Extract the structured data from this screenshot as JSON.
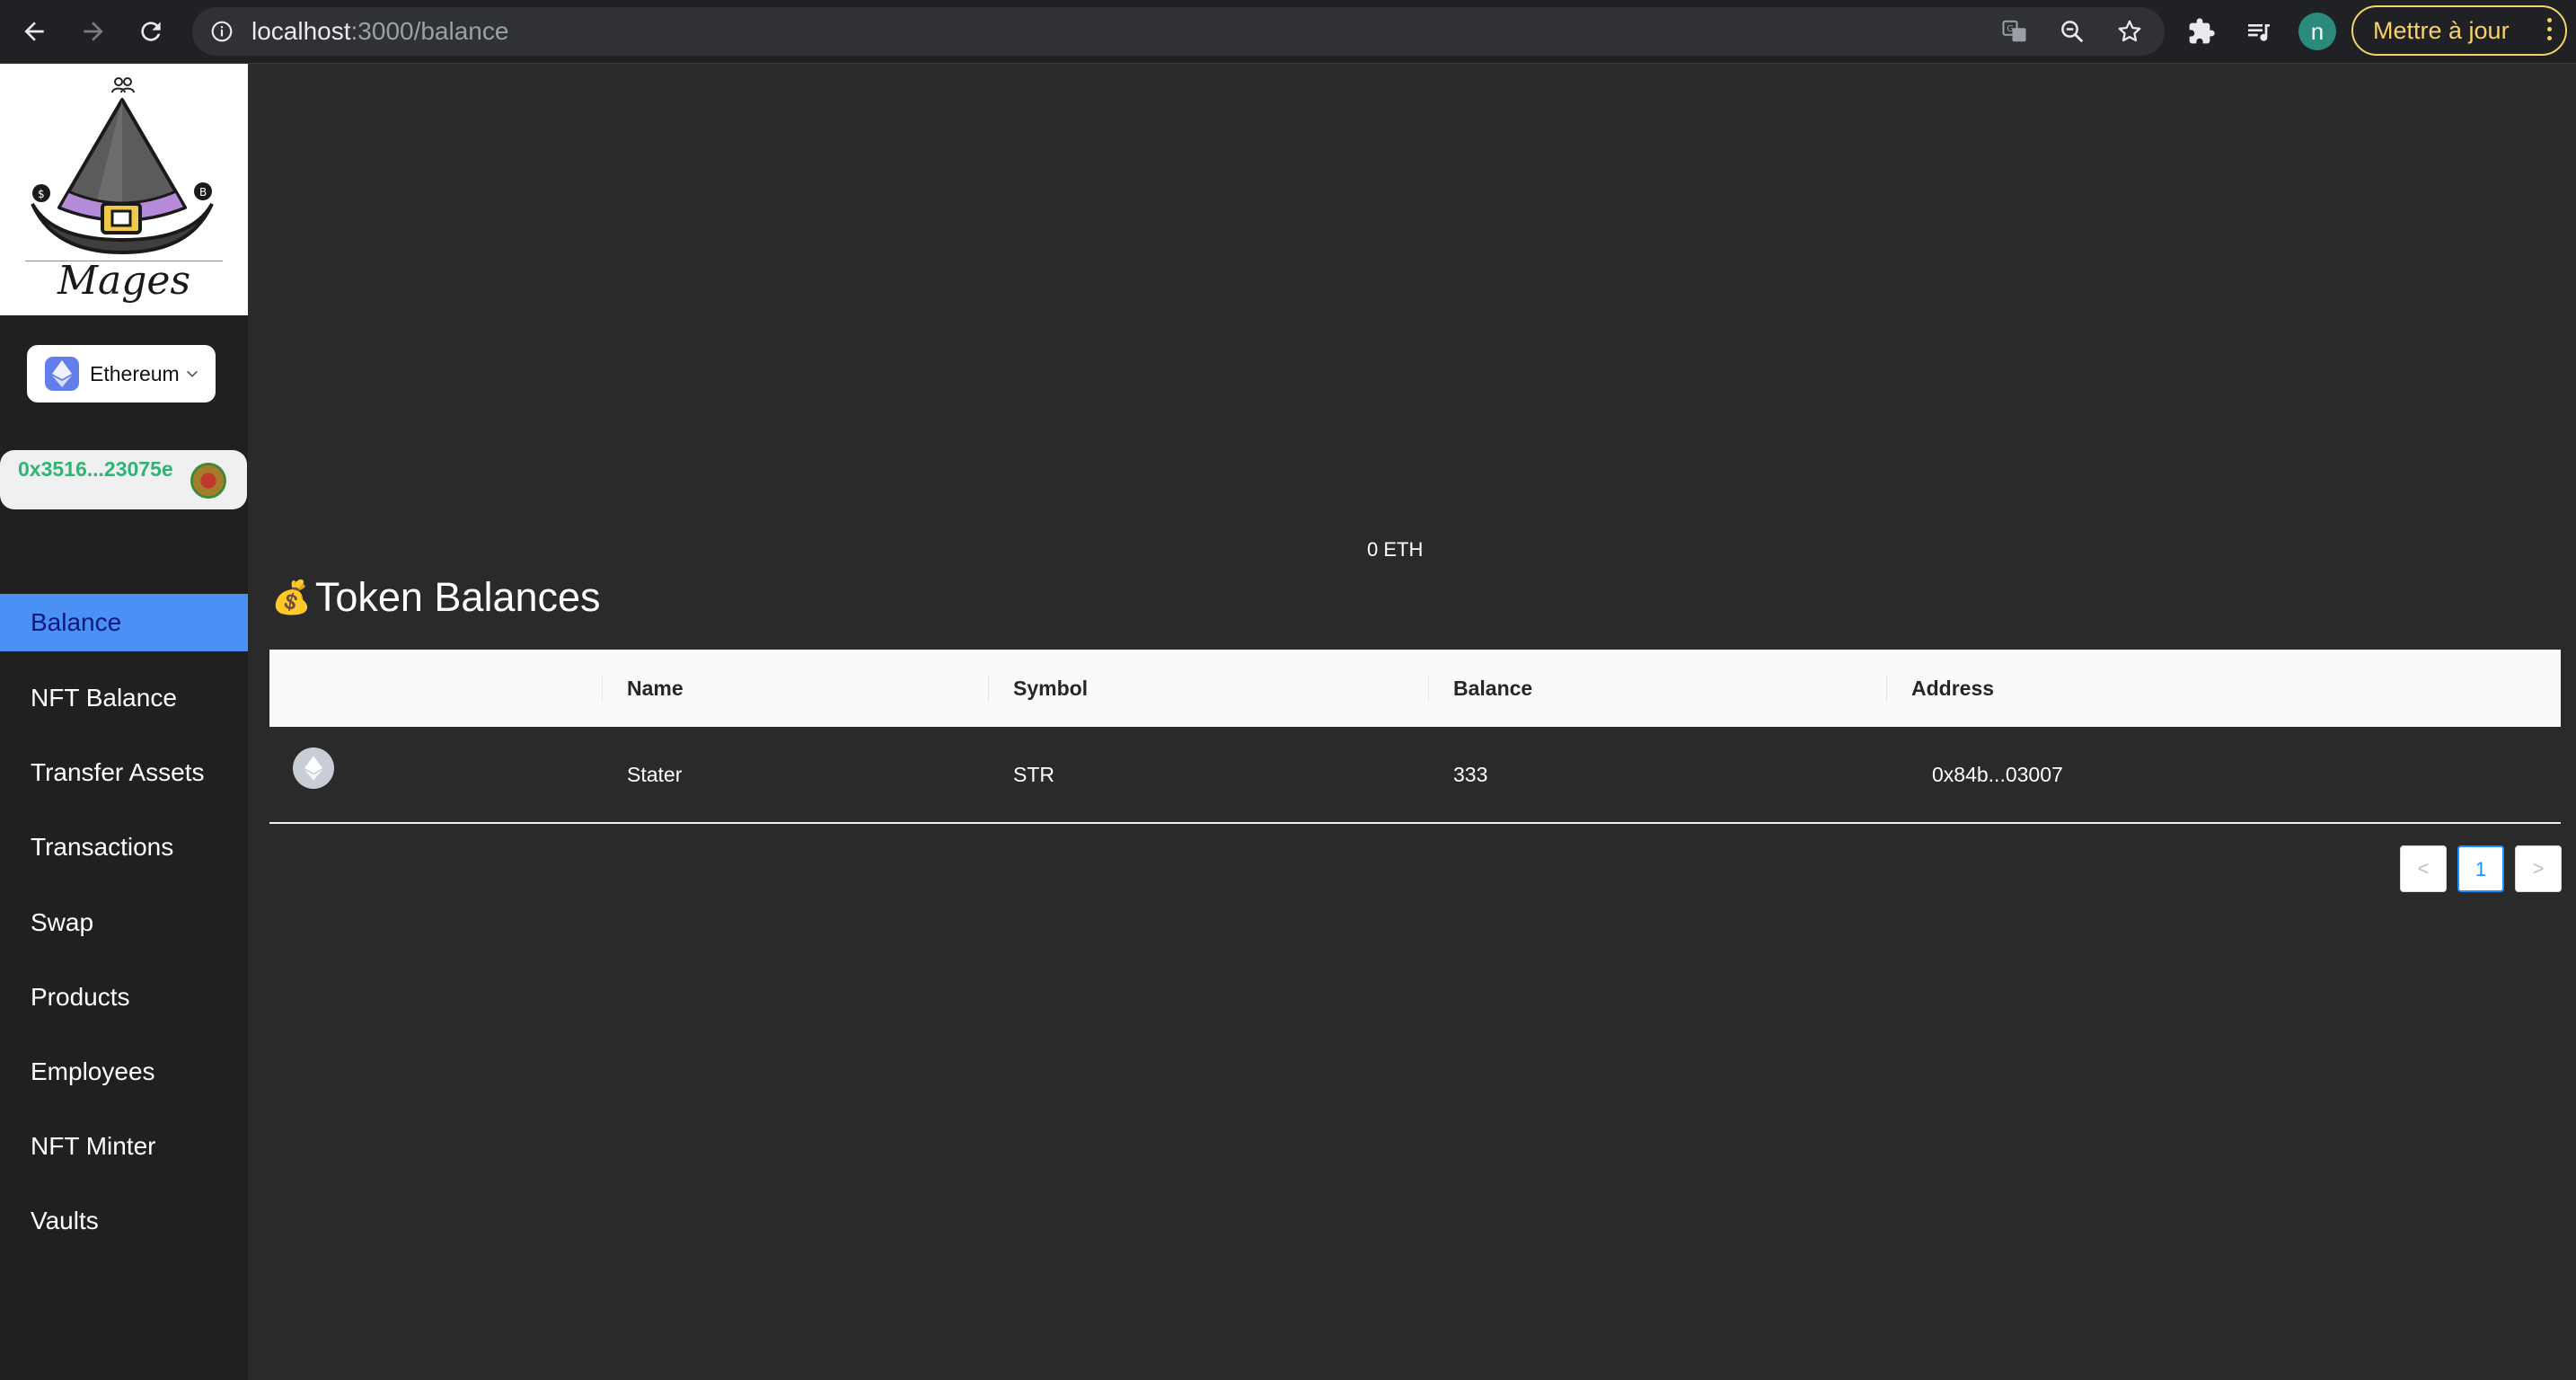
{
  "browser": {
    "url_host": "localhost",
    "url_path": ":3000/balance",
    "profile_initial": "n",
    "update_label": "Mettre à jour"
  },
  "sidebar": {
    "logo_text": "Mages",
    "chain": {
      "label": "Ethereum"
    },
    "account": {
      "address": "0x3516...23075e"
    },
    "menu": [
      {
        "label": "Balance",
        "active": true
      },
      {
        "label": "NFT Balance"
      },
      {
        "label": "Transfer Assets"
      },
      {
        "label": "Transactions"
      },
      {
        "label": "Swap"
      },
      {
        "label": "Products"
      },
      {
        "label": "Employees"
      },
      {
        "label": "NFT Minter"
      },
      {
        "label": "Vaults"
      }
    ]
  },
  "main": {
    "native_balance": "0 ETH",
    "section_title": "Token Balances",
    "section_icon": "money-bag-icon",
    "table": {
      "columns": [
        "",
        "Name",
        "Symbol",
        "Balance",
        "Address"
      ],
      "rows": [
        {
          "logo": "ethereum-icon",
          "name": "Stater",
          "symbol": "STR",
          "balance": "333",
          "address": "0x84b...03007"
        }
      ]
    },
    "pagination": {
      "prev": "<",
      "current": "1",
      "next": ">"
    }
  },
  "colors": {
    "accent": "#4a90f5",
    "account_text": "#2bb673",
    "update_button": "#f7d26a",
    "page_background": "#2a2a2a"
  }
}
